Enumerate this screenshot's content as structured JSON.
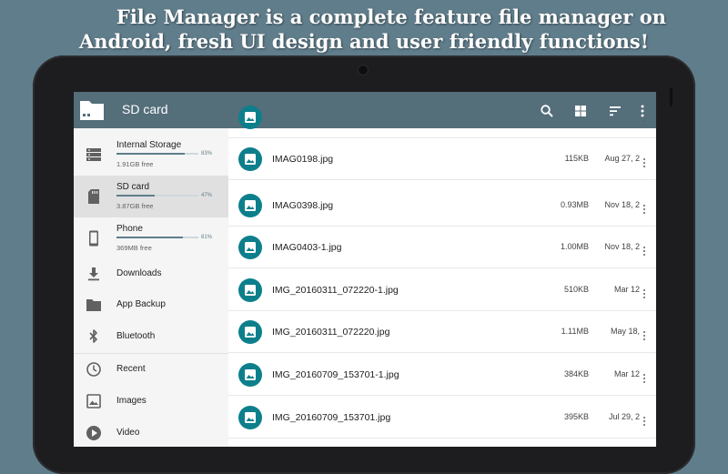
{
  "promo": {
    "line1": "File Manager is a complete feature file manager on",
    "line2": "Android, fresh UI design and user friendly functions!"
  },
  "toolbar": {
    "title": "SD card",
    "icons": [
      "folder-icon",
      "search-icon",
      "grid-view-icon",
      "sort-icon",
      "more-vert-icon"
    ]
  },
  "drawer": {
    "storage": [
      {
        "name": "Internal Storage",
        "free": "1.91GB free",
        "percent": "83%",
        "usage": 0.83,
        "icon": "storage-icon"
      },
      {
        "name": "SD card",
        "free": "3.87GB free",
        "percent": "47%",
        "usage": 0.47,
        "icon": "sd-card-icon"
      },
      {
        "name": "Phone",
        "free": "369MB free",
        "percent": "81%",
        "usage": 0.81,
        "icon": "phone-icon"
      }
    ],
    "nav": [
      {
        "label": "Downloads",
        "icon": "download-icon"
      },
      {
        "label": "App Backup",
        "icon": "folder-icon"
      },
      {
        "label": "Bluetooth",
        "icon": "bluetooth-icon"
      },
      {
        "label": "Recent",
        "icon": "clock-icon"
      },
      {
        "label": "Images",
        "icon": "image-icon"
      },
      {
        "label": "Video",
        "icon": "play-icon"
      }
    ]
  },
  "files": [
    {
      "name": "IMAG0198.jpg",
      "size": "115KB",
      "date": "Aug 27, 2"
    },
    {
      "name": "IMAG0398.jpg",
      "size": "0.93MB",
      "date": "Nov 18, 2"
    },
    {
      "name": "IMAG0403-1.jpg",
      "size": "1.00MB",
      "date": "Nov 18, 2"
    },
    {
      "name": "IMG_20160311_072220-1.jpg",
      "size": "510KB",
      "date": "Mar 12"
    },
    {
      "name": "IMG_20160311_072220.jpg",
      "size": "1.11MB",
      "date": "May 18,"
    },
    {
      "name": "IMG_20160709_153701-1.jpg",
      "size": "384KB",
      "date": "Mar 12"
    },
    {
      "name": "IMG_20160709_153701.jpg",
      "size": "395KB",
      "date": "Jul 29, 2"
    }
  ],
  "colors": {
    "background": "#607d8b",
    "toolbar": "#546e7a",
    "thumb": "#0d7f8c",
    "drawer_bg": "#f5f5f5",
    "active_item": "#e0e0e0"
  }
}
